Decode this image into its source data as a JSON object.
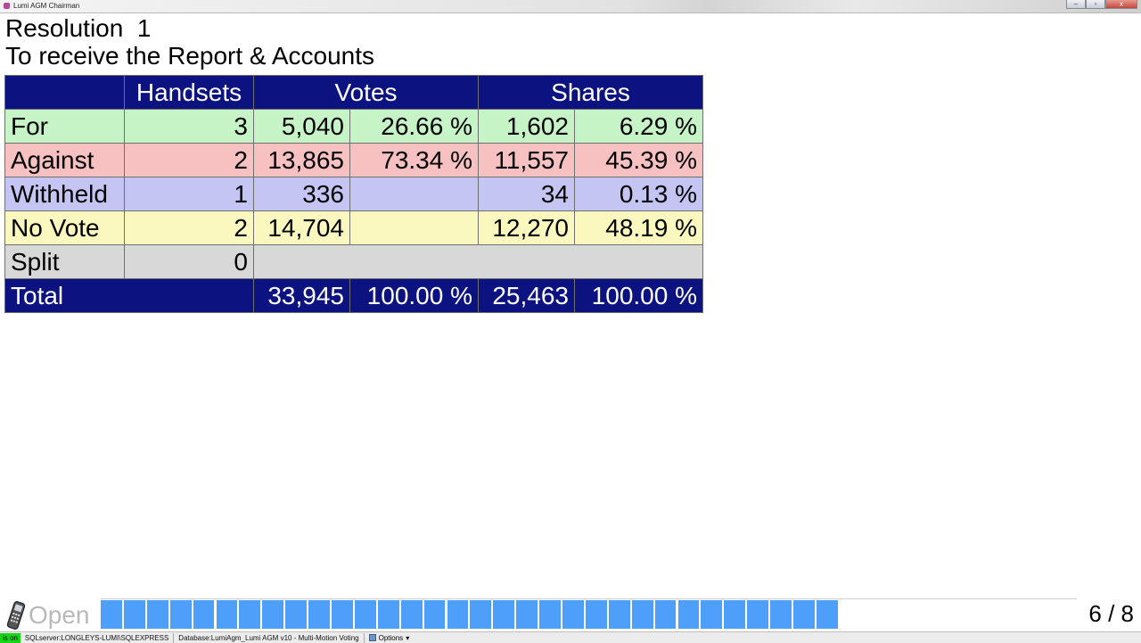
{
  "window": {
    "title": "Lumi AGM Chairman",
    "minimize": "–",
    "maximize": "▫",
    "close": "x"
  },
  "resolution": {
    "title": "Resolution  1",
    "subtitle": "To receive the Report & Accounts"
  },
  "table": {
    "headers": {
      "blank": "",
      "handsets": "Handsets",
      "votes": "Votes",
      "shares": "Shares"
    },
    "rows": {
      "for": {
        "label": "For",
        "handsets": "3",
        "votes": "5,040",
        "votes_pct": "26.66 %",
        "shares": "1,602",
        "shares_pct": "6.29 %"
      },
      "against": {
        "label": "Against",
        "handsets": "2",
        "votes": "13,865",
        "votes_pct": "73.34 %",
        "shares": "11,557",
        "shares_pct": "45.39 %"
      },
      "withheld": {
        "label": "Withheld",
        "handsets": "1",
        "votes": "336",
        "votes_pct": "",
        "shares": "34",
        "shares_pct": "0.13 %"
      },
      "novote": {
        "label": "No Vote",
        "handsets": "2",
        "votes": "14,704",
        "votes_pct": "",
        "shares": "12,270",
        "shares_pct": "48.19 %"
      },
      "split": {
        "label": "Split",
        "handsets": "0"
      },
      "total": {
        "label": "Total",
        "votes": "33,945",
        "votes_pct": "100.00 %",
        "shares": "25,463",
        "shares_pct": "100.00 %"
      }
    }
  },
  "status": {
    "state": "Open",
    "progress_segments_filled": 32,
    "page_counter": "6 / 8"
  },
  "statusbar": {
    "on": "is on",
    "server": "SQLserver:LONGLEYS-LUMI\\SQLEXPRESS",
    "database": "Database:LumiAgm_Lumi AGM v10 - Multi-Motion Voting",
    "options": "Options",
    "options_arrow": "▾"
  },
  "colors": {
    "header": "#0c1280",
    "for": "#c6f4c6",
    "against": "#f7c1c1",
    "withheld": "#c5c5f4",
    "novote": "#fbf8bf",
    "split": "#d8d8d8",
    "progress": "#4d9ff9"
  },
  "icons": [
    "handset-icon",
    "app-icon",
    "options-icon"
  ]
}
